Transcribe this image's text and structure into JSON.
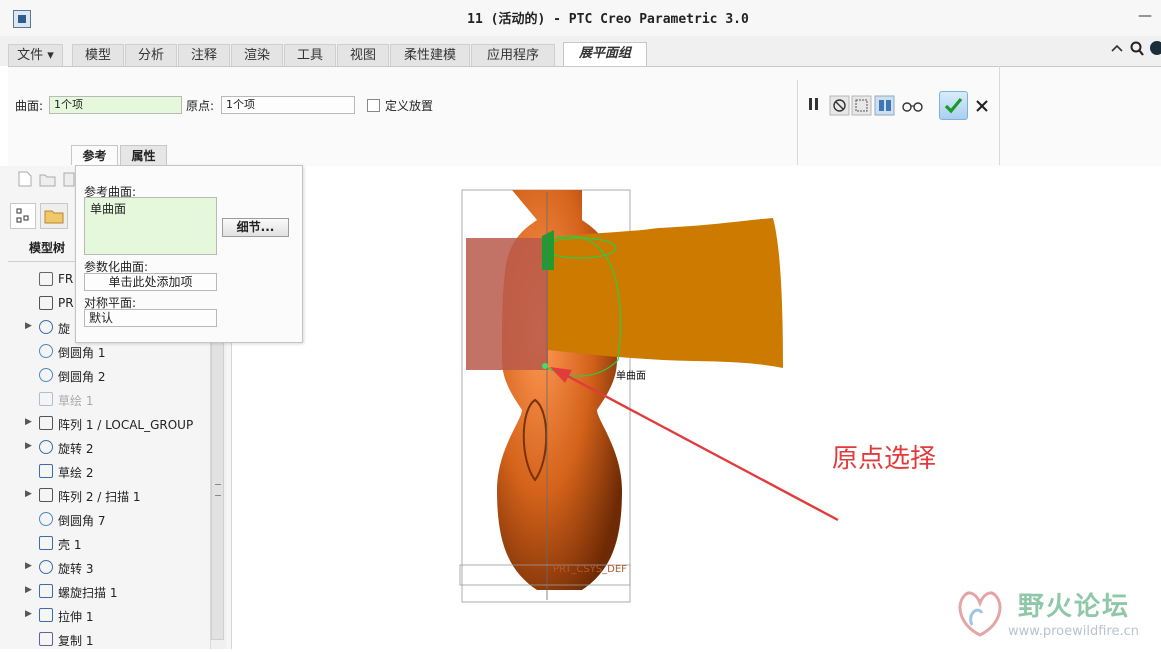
{
  "window": {
    "title": "11 (活动的) - PTC Creo Parametric 3.0",
    "minimize_glyph": "—"
  },
  "ribbon_tabs": [
    {
      "label": "文件 ▾"
    },
    {
      "label": "模型"
    },
    {
      "label": "分析"
    },
    {
      "label": "注释"
    },
    {
      "label": "渲染"
    },
    {
      "label": "工具"
    },
    {
      "label": "视图"
    },
    {
      "label": "柔性建模"
    },
    {
      "label": "应用程序"
    },
    {
      "label": "展平面组",
      "active": true
    }
  ],
  "dashboard": {
    "surface_label": "曲面:",
    "surface_value": "1个项",
    "origin_label": "原点:",
    "origin_value": "1个项",
    "define_place_label": "定义放置",
    "confirm_icon": "check-icon",
    "cancel_icon": "close-icon"
  },
  "subtabs": {
    "references": "参考",
    "properties": "属性"
  },
  "ref_panel": {
    "ref_surface_label": "参考曲面:",
    "ref_surface_item": "单曲面",
    "details_button": "细节...",
    "param_surface_label": "参数化曲面:",
    "param_surface_placeholder": "单击此处添加项",
    "sym_plane_label": "对称平面:",
    "sym_plane_value": "默认"
  },
  "model_tree": {
    "header": "模型树",
    "items": [
      {
        "label": "FR",
        "icon": "plane-icon",
        "expandable": false
      },
      {
        "label": "PR",
        "icon": "csys-icon",
        "expandable": false
      },
      {
        "label": "旋",
        "icon": "revolve-icon",
        "expandable": true
      },
      {
        "label": "倒圆角 1",
        "icon": "round-icon",
        "expandable": false
      },
      {
        "label": "倒圆角 2",
        "icon": "round-icon",
        "expandable": false
      },
      {
        "label": "草绘 1",
        "icon": "sketch-icon",
        "expandable": false,
        "dim": true
      },
      {
        "label": "阵列 1 / LOCAL_GROUP",
        "icon": "pattern-icon",
        "expandable": true
      },
      {
        "label": "旋转 2",
        "icon": "revolve-icon",
        "expandable": true
      },
      {
        "label": "草绘 2",
        "icon": "sketch-icon",
        "expandable": false
      },
      {
        "label": "阵列 2 / 扫描 1",
        "icon": "pattern-icon",
        "expandable": true
      },
      {
        "label": "倒圆角 7",
        "icon": "round-icon",
        "expandable": false
      },
      {
        "label": "壳 1",
        "icon": "shell-icon",
        "expandable": false
      },
      {
        "label": "旋转 3",
        "icon": "revolve-icon",
        "expandable": true
      },
      {
        "label": "螺旋扫描 1",
        "icon": "helical-sweep-icon",
        "expandable": true
      },
      {
        "label": "拉伸 1",
        "icon": "extrude-icon",
        "expandable": true
      },
      {
        "label": "复制 1",
        "icon": "copy-icon",
        "expandable": false
      }
    ]
  },
  "viewport": {
    "surface_tag": "单曲面",
    "csys_tag": "PRT_CSYS_DEF",
    "annotation": "原点选择",
    "bottle_color": "#d4621a",
    "flattened_color": "#cc7a00"
  },
  "watermark": {
    "name": "野火论坛",
    "url": "www.proewildfire.cn"
  }
}
